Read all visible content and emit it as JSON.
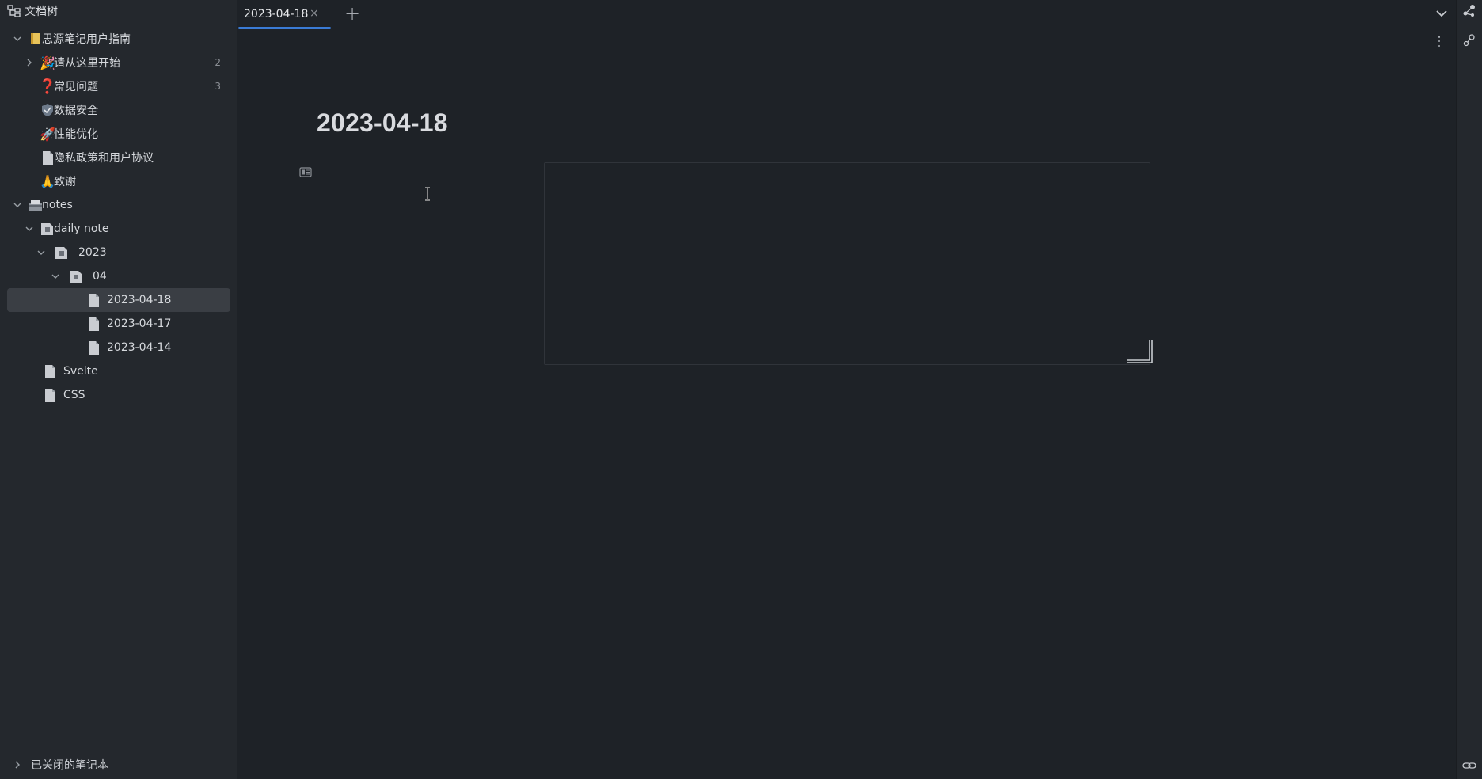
{
  "sidebar": {
    "title": "文档树",
    "closed_notebooks_label": "已关闭的笔记本",
    "items": [
      {
        "label": "思源笔记用户指南",
        "icon": "notebook-icon",
        "count": ""
      },
      {
        "label": "请从这里开始",
        "icon": "party-popper-icon",
        "count": "2"
      },
      {
        "label": "常见问题",
        "icon": "question-mark-icon",
        "count": "3"
      },
      {
        "label": "数据安全",
        "icon": "shield-check-icon",
        "count": ""
      },
      {
        "label": "性能优化",
        "icon": "rocket-icon",
        "count": ""
      },
      {
        "label": "隐私政策和用户协议",
        "icon": "document-icon",
        "count": ""
      },
      {
        "label": "致谢",
        "icon": "folded-hands-icon",
        "count": ""
      },
      {
        "label": "notes",
        "icon": "card-box-icon",
        "count": ""
      },
      {
        "label": "daily note",
        "icon": "folder-document-icon",
        "count": ""
      },
      {
        "label": "2023",
        "icon": "folder-document-icon",
        "count": ""
      },
      {
        "label": "04",
        "icon": "folder-document-icon",
        "count": ""
      },
      {
        "label": "2023-04-18",
        "icon": "document-icon",
        "count": ""
      },
      {
        "label": "2023-04-17",
        "icon": "document-icon",
        "count": ""
      },
      {
        "label": "2023-04-14",
        "icon": "document-icon",
        "count": ""
      },
      {
        "label": "Svelte",
        "icon": "document-icon",
        "count": ""
      },
      {
        "label": "CSS",
        "icon": "document-icon",
        "count": ""
      }
    ]
  },
  "tabs": {
    "active_label": "2023-04-18",
    "close_glyph": "×",
    "add_glyph": "+"
  },
  "editor": {
    "title": "2023-04-18"
  },
  "colors": {
    "background": "#1e2227",
    "sidebar": "#24282d",
    "accent": "#3a7bd5",
    "selected_row": "#3a3e44"
  }
}
